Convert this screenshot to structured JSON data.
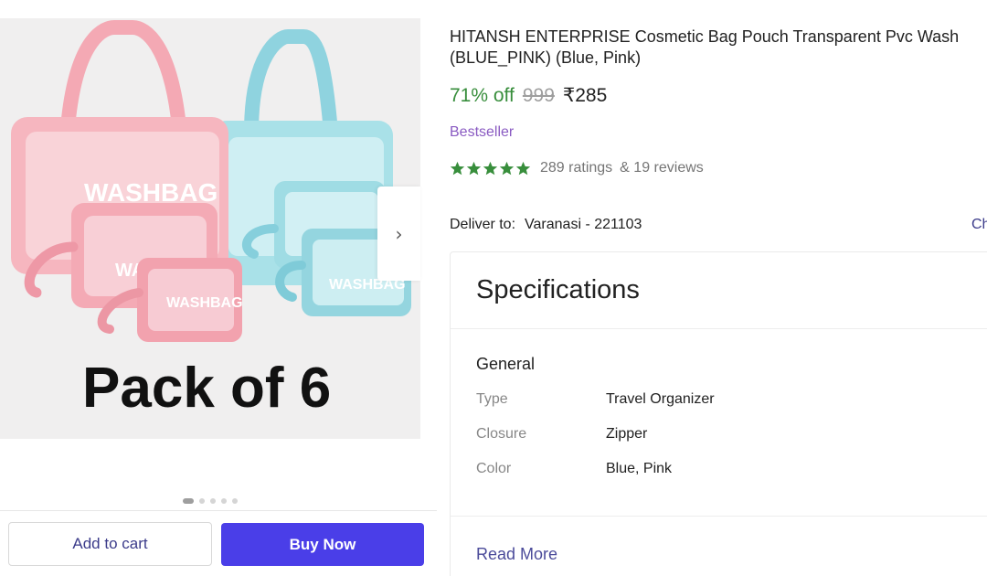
{
  "product": {
    "title_line1": "HITANSH ENTERPRISE Cosmetic Bag Pouch Transparent Pvc Wash",
    "title_line2": "(BLUE_PINK) (Blue, Pink)",
    "discount": "71% off",
    "mrp": "999",
    "price": "₹285",
    "badge": "Bestseller",
    "rating_stars": 5,
    "ratings_count": "289 ratings",
    "reviews_count": "& 19 reviews",
    "star_color": "#388e3c"
  },
  "image": {
    "overlay_text": "Pack of 6",
    "bag_label": "WASHBAG",
    "carousel_count": 5,
    "carousel_active_index": 0,
    "next_icon": "chevron-right-icon"
  },
  "delivery": {
    "label": "Deliver to:",
    "location": "Varanasi - 221103",
    "change_label": "Ch"
  },
  "specifications": {
    "title": "Specifications",
    "group": "General",
    "rows": [
      {
        "key": "Type",
        "value": "Travel Organizer"
      },
      {
        "key": "Closure",
        "value": "Zipper"
      },
      {
        "key": "Color",
        "value": "Blue, Pink"
      }
    ],
    "read_more": "Read More"
  },
  "actions": {
    "add_to_cart": "Add to cart",
    "buy_now": "Buy Now",
    "buy_now_color": "#4a3ee8"
  }
}
